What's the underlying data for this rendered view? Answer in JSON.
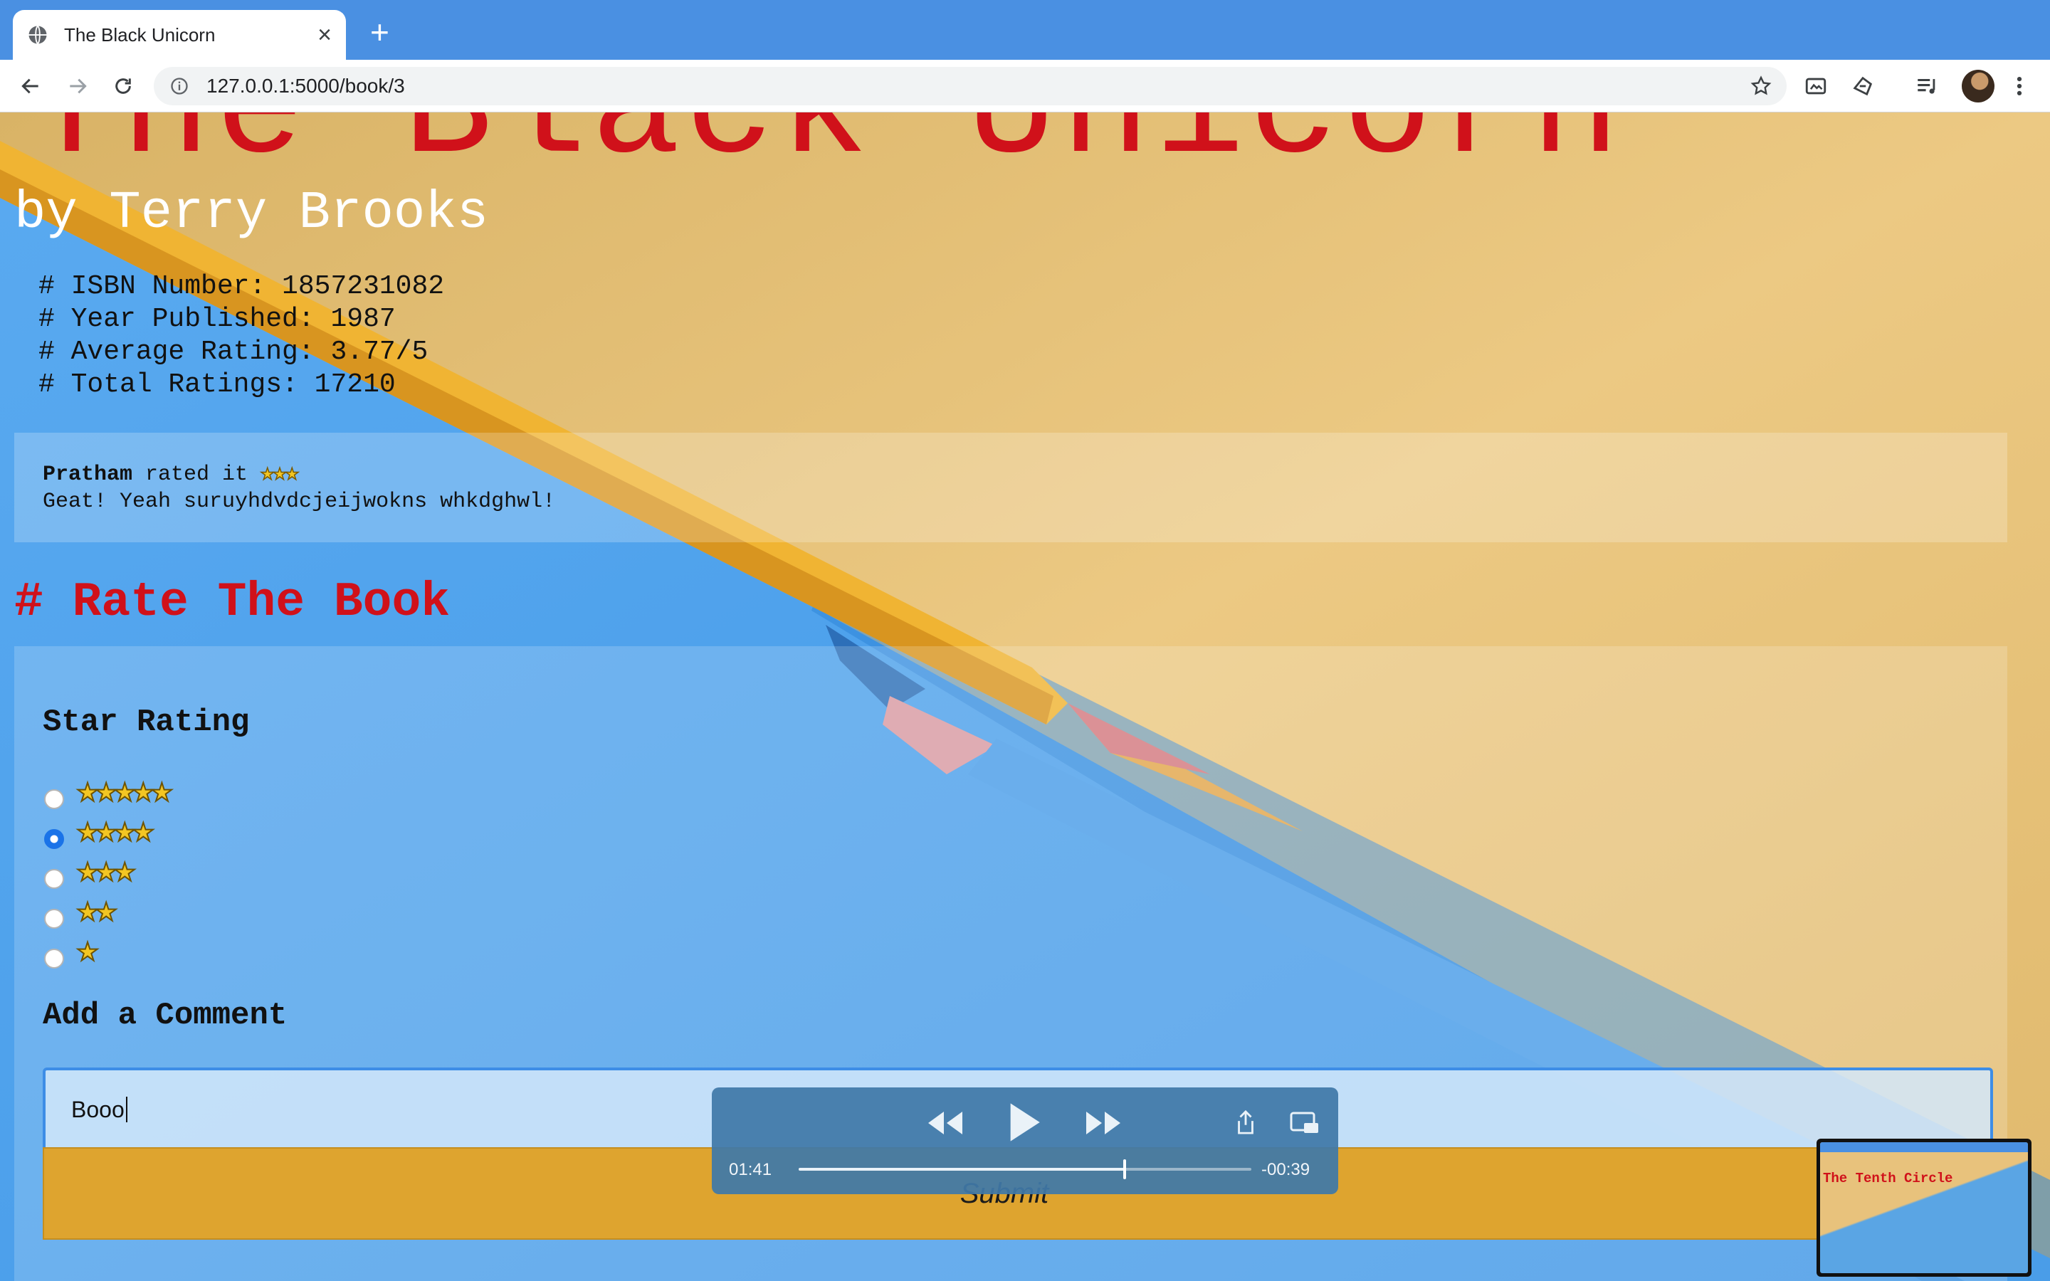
{
  "browser": {
    "tab_title": "The Black Unicorn",
    "url": "127.0.0.1:5000/book/3"
  },
  "page": {
    "title": "The Black Unicorn",
    "author_line": "by Terry Brooks",
    "meta": [
      "# ISBN Number: 1857231082",
      "# Year Published: 1987",
      "# Average Rating: 3.77/5",
      "# Total Ratings: 17210"
    ],
    "review": {
      "user": "Pratham",
      "rated_text": " rated it ",
      "stars": "★★★",
      "rating": 3,
      "comment": "Geat! Yeah suruyhdvdcjeijwokns whkdghwl!"
    },
    "rate_heading": "# Rate The Book",
    "star_rating_label": "Star Rating",
    "rating_options": [
      {
        "stars": "★★★★★",
        "value": 5,
        "checked": false
      },
      {
        "stars": "★★★★",
        "value": 4,
        "checked": true
      },
      {
        "stars": "★★★",
        "value": 3,
        "checked": false
      },
      {
        "stars": "★★",
        "value": 2,
        "checked": false
      },
      {
        "stars": "★",
        "value": 1,
        "checked": false
      }
    ],
    "comment_label": "Add a Comment",
    "comment_value": "Booo",
    "submit_label": "Submit"
  },
  "media_player": {
    "elapsed": "01:41",
    "remaining": "-00:39",
    "progress": 0.72
  },
  "pip": {
    "title": "The Tenth Circle"
  },
  "icons": [
    "globe-icon",
    "close-icon",
    "plus-icon",
    "back-icon",
    "forward-icon",
    "reload-icon",
    "info-icon",
    "star-icon",
    "media-icon",
    "extension-icon",
    "playlist-icon",
    "menu-icon",
    "rewind-icon",
    "play-icon",
    "fast-forward-icon",
    "share-icon",
    "pip-icon"
  ],
  "colors": {
    "title_red": "#d0111a",
    "submit": "#dea42f",
    "chrome_blue": "#4a90e2"
  }
}
